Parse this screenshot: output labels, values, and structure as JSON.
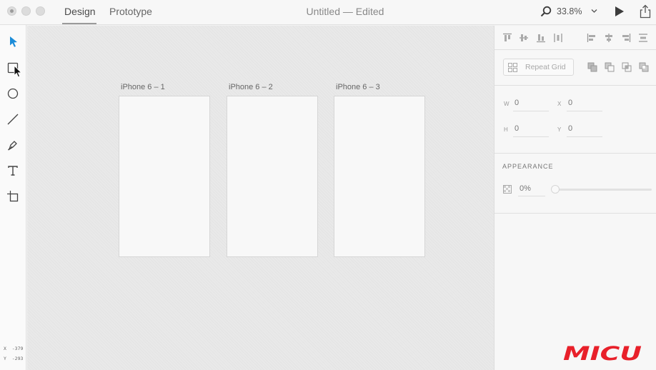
{
  "titlebar": {
    "tabs": [
      {
        "label": "Design",
        "active": true
      },
      {
        "label": "Prototype",
        "active": false
      }
    ],
    "document_title": "Untitled — Edited",
    "zoom": "33.8%"
  },
  "toolbar": {
    "tools": [
      {
        "name": "select",
        "icon": "pointer-arrow-icon",
        "active": true
      },
      {
        "name": "rectangle",
        "icon": "rectangle-icon"
      },
      {
        "name": "ellipse",
        "icon": "ellipse-icon"
      },
      {
        "name": "line",
        "icon": "line-icon"
      },
      {
        "name": "pen",
        "icon": "pen-icon"
      },
      {
        "name": "text",
        "icon": "text-icon"
      },
      {
        "name": "artboard",
        "icon": "artboard-icon"
      }
    ],
    "coords": {
      "x_label": "X",
      "x_value": "-379",
      "y_label": "Y",
      "y_value": "-293"
    }
  },
  "canvas": {
    "artboards": [
      {
        "label": "iPhone 6 – 1"
      },
      {
        "label": "iPhone 6 – 2"
      },
      {
        "label": "iPhone 6 – 3"
      }
    ]
  },
  "panel": {
    "repeat_grid": "Repeat Grid",
    "fields": {
      "w_label": "W",
      "w_value": "0",
      "x_label": "X",
      "x_value": "0",
      "h_label": "H",
      "h_value": "0",
      "y_label": "Y",
      "y_value": "0"
    },
    "appearance_title": "APPEARANCE",
    "opacity": "0%",
    "opacity_level": 0
  },
  "watermark": "MICU",
  "colors": {
    "accent": "#1c8cd8",
    "watermark": "#e8202a"
  }
}
